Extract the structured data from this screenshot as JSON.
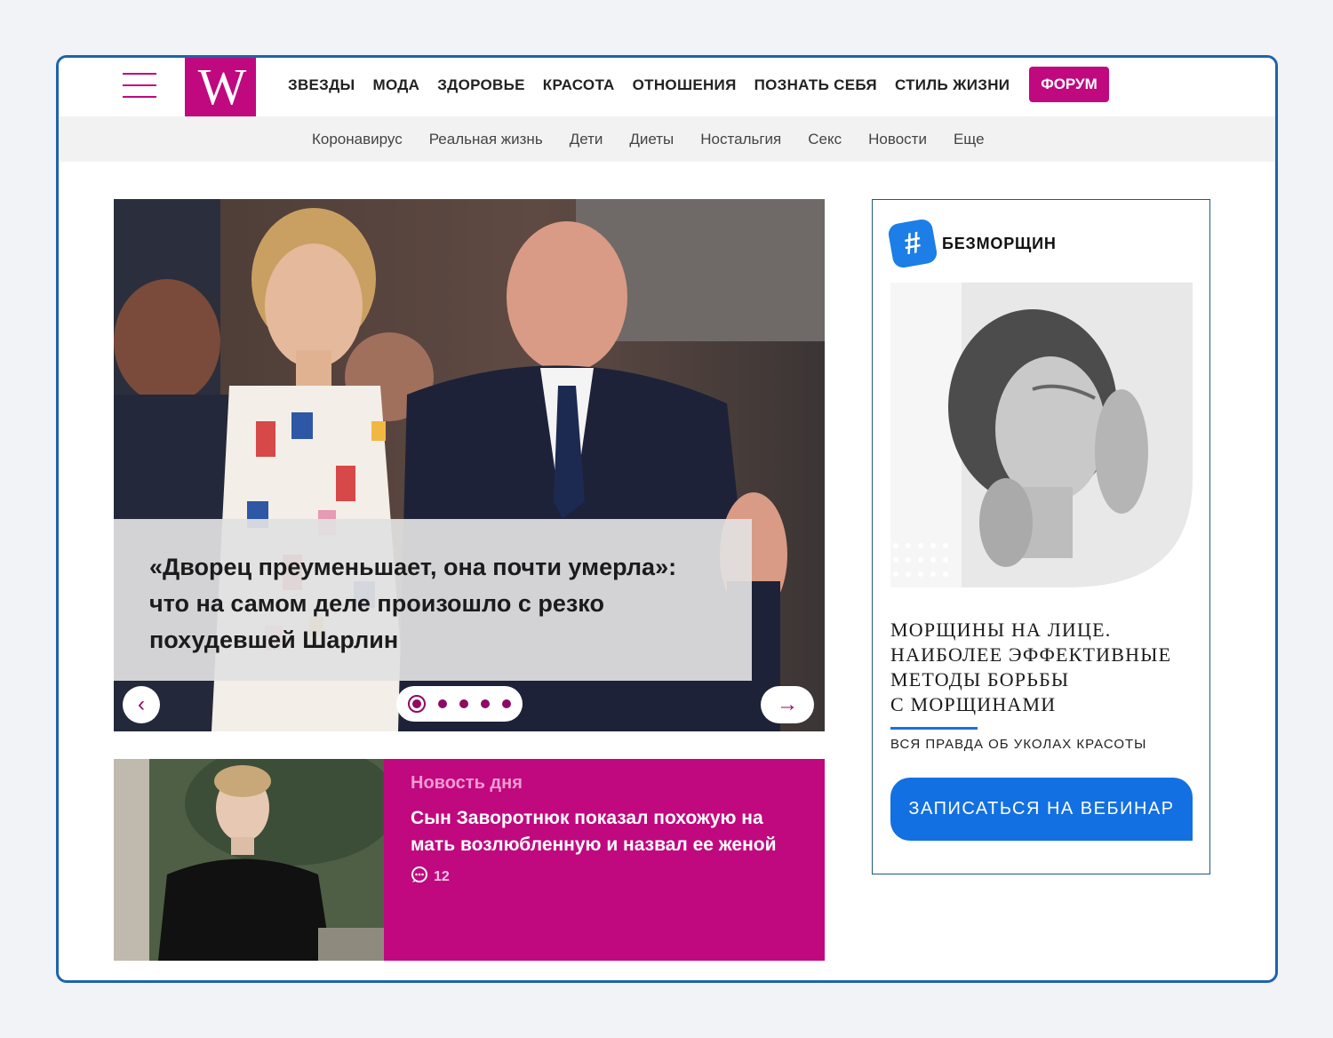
{
  "header": {
    "logo_text": "W",
    "nav": [
      "ЗВЕЗДЫ",
      "МОДА",
      "ЗДОРОВЬЕ",
      "КРАСОТА",
      "ОТНОШЕНИЯ",
      "ПОЗНАТЬ СЕБЯ",
      "СТИЛЬ ЖИЗНИ"
    ],
    "forum_label": "ФОРУМ"
  },
  "subnav": [
    "Коронавирус",
    "Реальная жизнь",
    "Дети",
    "Диеты",
    "Ностальгия",
    "Секс",
    "Новости",
    "Еще"
  ],
  "hero": {
    "title": "«Дворец преуменьшает, она почти умерла»: что на самом деле произошло с резко похудевшей Шарлин",
    "left_arrow": "‹",
    "right_arrow": "→",
    "slide_count": 5,
    "active_slide": 1
  },
  "news": {
    "tag": "Новость дня",
    "title": "Сын Заворотнюк показал похожую на мать возлюбленную и назвал ее женой",
    "comments": "12"
  },
  "ad": {
    "brand": "БЕЗМОРЩИН",
    "brand_icon": "#",
    "headline_lines": [
      "МОРЩИНЫ НА ЛИЦЕ.",
      "НАИБОЛЕЕ ЭФФЕКТИВНЫЕ",
      "МЕТОДЫ БОРЬБЫ",
      "С МОРЩИНАМИ"
    ],
    "subtitle": "ВСЯ ПРАВДА ОБ УКОЛАХ КРАСОТЫ",
    "cta": "ЗАПИСАТЬСЯ НА ВЕБИНАР"
  },
  "colors": {
    "brand": "#c0087f",
    "frame": "#1d63ad",
    "ad_cta": "#1370e2"
  }
}
